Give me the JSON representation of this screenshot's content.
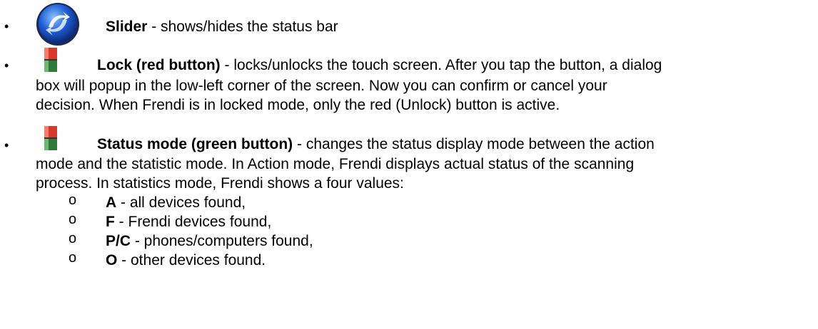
{
  "items": [
    {
      "icon": "slider-icon",
      "title": "Slider",
      "desc": " - shows/hides the status bar"
    },
    {
      "icon": "lock-button-icon",
      "title": "Lock (red button)",
      "desc": " - locks/unlocks the touch screen. After you tap the button, a dialog",
      "lines": [
        "box will popup in the low-left corner of the screen. Now you can confirm or cancel your",
        "decision. When Frendi is in locked mode, only the red (Unlock) button is active."
      ]
    },
    {
      "icon": "status-button-icon",
      "title": "Status mode (green button)",
      "desc": "  - changes the status display mode between the action",
      "lines": [
        "mode and the statistic mode. In Action mode, Frendi displays actual status of the scanning",
        "process. In statistics mode, Frendi shows a four values:"
      ],
      "subitems": [
        {
          "key": "A",
          "text": " - all devices found,"
        },
        {
          "key": "F",
          "text": " - Frendi devices found,"
        },
        {
          "key": "P/C",
          "text": " - phones/computers found,"
        },
        {
          "key": "O",
          "text": " - other devices found."
        }
      ]
    }
  ],
  "sub_bullet": "o",
  "bullet": "•"
}
